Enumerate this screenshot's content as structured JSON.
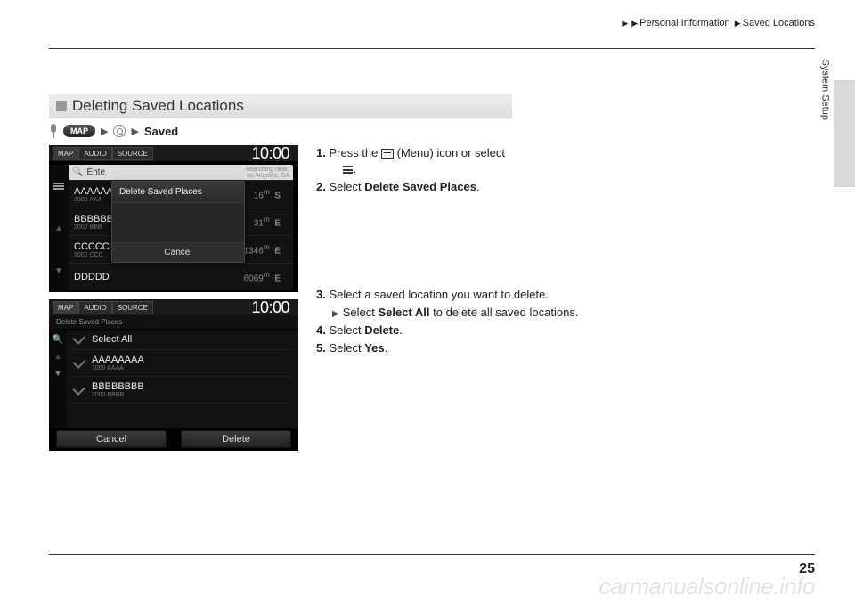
{
  "header": {
    "path1": "Personal Information",
    "path2": "Saved Locations"
  },
  "section": {
    "title": "Deleting Saved Locations",
    "nav_map": "MAP",
    "nav_end": "Saved"
  },
  "screenshot1": {
    "tabs": {
      "map": "MAP",
      "audio": "AUDIO",
      "source": "SOURCE"
    },
    "time": "10:00",
    "search_placeholder": "Ente",
    "search_hint1": "Searching near:",
    "search_hint2": "os Angeles, CA",
    "rows": [
      {
        "name": "AAAAAA",
        "sub": "1000 AAA",
        "dist": "16",
        "dir": "S"
      },
      {
        "name": "BBBBBB",
        "sub": "2000 BBB",
        "dist": "31",
        "dir": "E"
      },
      {
        "name": "CCCCC",
        "sub": "3000 CCC",
        "dist": "1346",
        "dir": "E"
      },
      {
        "name": "DDDDD",
        "sub": "",
        "dist": "6069",
        "dir": "E"
      }
    ],
    "modal_title": "Delete Saved Places",
    "modal_cancel": "Cancel"
  },
  "screenshot2": {
    "tabs": {
      "map": "MAP",
      "audio": "AUDIO",
      "source": "SOURCE"
    },
    "time": "10:00",
    "crumb": "Delete Saved Places",
    "select_all": "Select All",
    "rows": [
      {
        "name": "AAAAAAAA",
        "sub": "1000 AAAA"
      },
      {
        "name": "BBBBBBBB",
        "sub": "2000 BBBB"
      }
    ],
    "cancel": "Cancel",
    "delete": "Delete"
  },
  "instructions": {
    "step1a": "Press the ",
    "step1b": " (Menu) icon or select ",
    "step1c": ".",
    "step2a": "Select ",
    "step2b": "Delete Saved Places",
    "step2c": ".",
    "step3": "Select a saved location you want to delete.",
    "step3sub_a": "Select ",
    "step3sub_b": "Select All",
    "step3sub_c": " to delete all saved locations.",
    "step4a": "Select ",
    "step4b": "Delete",
    "step4c": ".",
    "step5a": "Select ",
    "step5b": "Yes",
    "step5c": "."
  },
  "side_tab": "System Setup",
  "page_number": "25",
  "watermark": "carmanualsonline.info"
}
